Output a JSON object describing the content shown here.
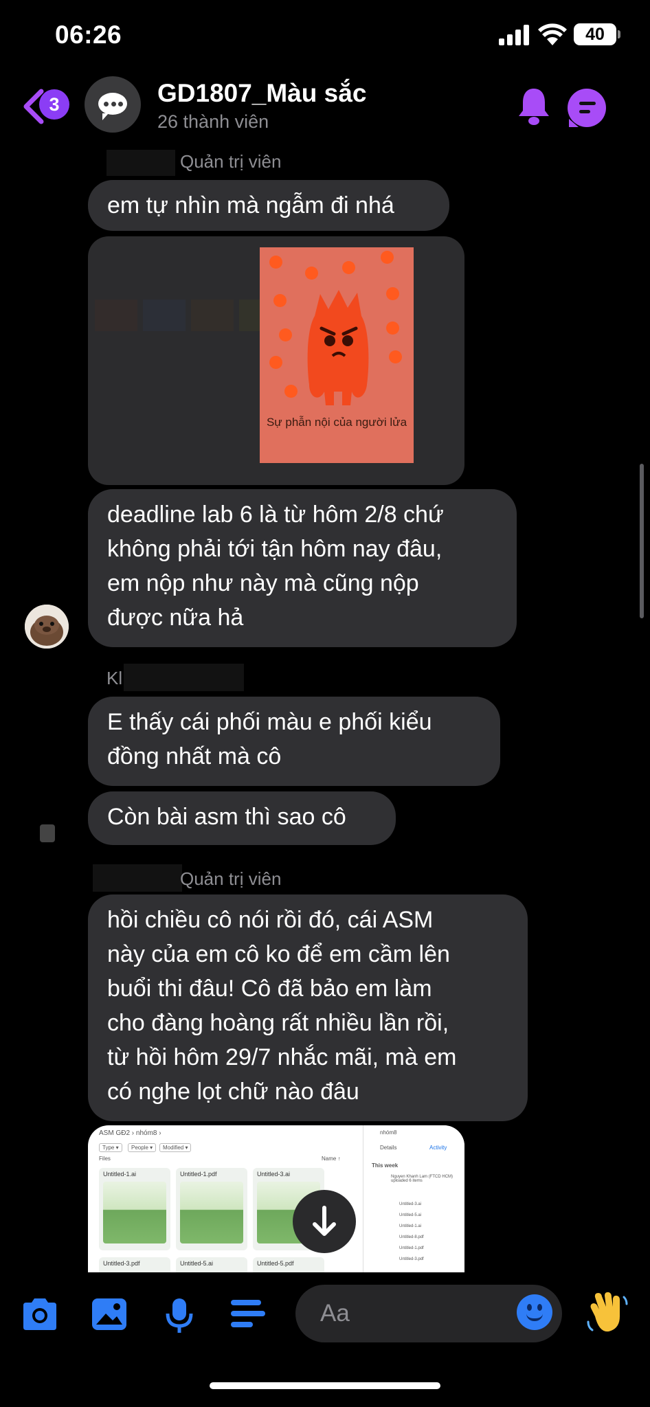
{
  "status_bar": {
    "time": "06:26",
    "battery": "40"
  },
  "header": {
    "unread_count": "3",
    "title": "GD1807_Màu sắc",
    "subtitle": "26 thành viên"
  },
  "messages": {
    "admin_label_1": "Quản trị viên",
    "msg1": "em tự nhìn mà ngẫm đi nhá",
    "poster_caption": "Sự phẫn nội của người lửa",
    "msg2_lines": [
      "deadline lab 6 là từ hôm 2/8 chứ",
      "không phải tới tận hôm nay đâu,",
      "em nộp như này mà cũng nộp",
      "được nữa hả"
    ],
    "sender_initial": "Kl",
    "msg3_lines": [
      "E thấy cái phối màu e phối kiểu",
      "đồng nhất mà cô"
    ],
    "msg4": "Còn bài asm thì sao cô",
    "admin_label_2": "Quản trị viên",
    "msg5_lines": [
      "hồi chiều cô nói rồi đó, cái ASM",
      "này của em cô ko để em cầm lên",
      "buổi thi đâu! Cô đã bảo em làm",
      "cho đàng hoàng rất nhiều lần rồi,",
      "từ hồi hôm 29/7 nhắc mãi, mà em",
      "có nghe lọt chữ nào đâu"
    ]
  },
  "drive_screenshot": {
    "breadcrumb": "ASM GĐ2  ›  nhóm8  ›",
    "filters": [
      "Type ▾",
      "People ▾",
      "Modified ▾"
    ],
    "files_label": "Files",
    "sort_label": "Name ↑",
    "files": [
      "Untitled-1.ai",
      "Untitled-1.pdf",
      "Untitled-3.ai",
      "Untitled-3.pdf",
      "Untitled-5.ai",
      "Untitled-5.pdf"
    ],
    "panel_title": "nhóm8",
    "panel_tabs": [
      "Details",
      "Activity"
    ],
    "this_week": "This week",
    "activity_text": "Nguyen Khanh Lam (FTCD HCM) uploaded 6 items",
    "activity_files": [
      "Untitled-3.ai",
      "Untitled-5.ai",
      "Untitled-1.ai",
      "Untitled-8.pdf",
      "Untitled-1.pdf",
      "Untitled-3.pdf"
    ]
  },
  "composer": {
    "placeholder": "Aa"
  },
  "colors": {
    "accent": "#a84cf7",
    "bubble": "#303033",
    "icon_blue": "#2f7df6"
  },
  "icons": [
    "camera-icon",
    "gallery-icon",
    "microphone-icon",
    "menu-icon",
    "emoji-icon",
    "waving-hand-icon",
    "bell-icon",
    "threads-icon",
    "scroll-down-icon"
  ]
}
